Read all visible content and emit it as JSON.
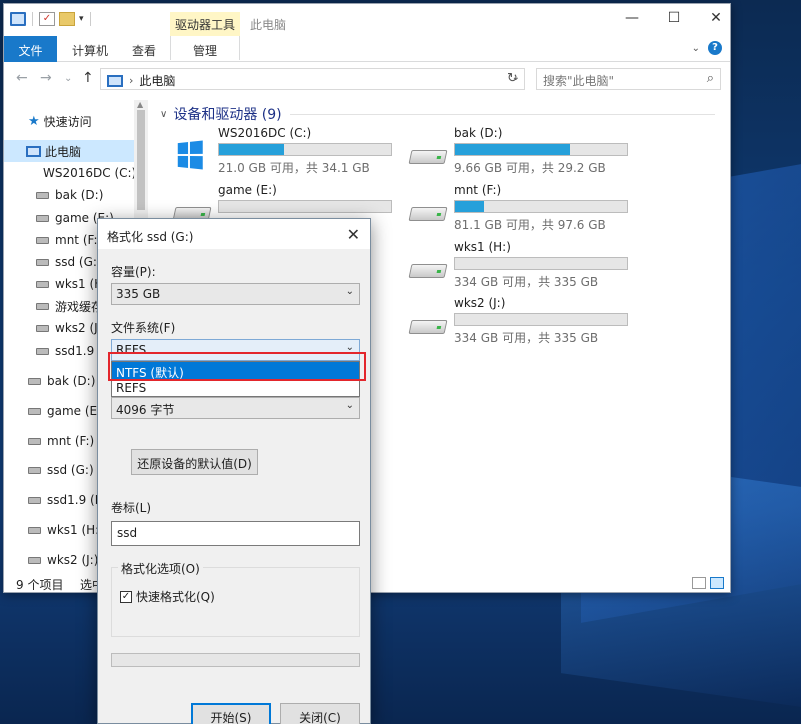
{
  "explorer": {
    "title": "此电脑",
    "ribbon": {
      "file_tab": "文件",
      "tabs": [
        "计算机",
        "查看"
      ],
      "context_header": "驱动器工具",
      "manage_tab": "管理",
      "help_icon": "?"
    },
    "address": {
      "path": "此电脑",
      "search_placeholder": "搜索\"此电脑\""
    },
    "nav": {
      "quick_access": "快速访问",
      "this_pc": "此电脑",
      "items": [
        "WS2016DC (C:)",
        "bak (D:)",
        "game (E:)",
        "mnt (F:)",
        "ssd (G:)",
        "wks1 (H:)",
        "游戏缓存",
        "wks2 (J:)",
        "ssd1.9",
        "bak (D:)",
        "game (E:)",
        "mnt (F:)",
        "ssd (G:)",
        "ssd1.9 (K:)",
        "wks1 (H:)",
        "wks2 (J:)"
      ]
    },
    "group_title": "设备和驱动器 (9)",
    "drives": [
      {
        "name": "WS2016DC (C:)",
        "info": "21.0 GB 可用，共 34.1 GB",
        "used_fraction": 0.38,
        "icon": "windows-drive-icon"
      },
      {
        "name": "bak (D:)",
        "info": "9.66 GB 可用，共 29.2 GB",
        "used_fraction": 0.67,
        "icon": "hard-drive-icon"
      },
      {
        "name": "game (E:)",
        "info": "",
        "used_fraction": 0.0,
        "icon": "hard-drive-icon"
      },
      {
        "name": "mnt (F:)",
        "info": "81.1 GB 可用，共 97.6 GB",
        "used_fraction": 0.17,
        "icon": "hard-drive-icon"
      },
      {
        "name": "wks1 (H:)",
        "info": "334 GB 可用，共 335 GB",
        "used_fraction": 0.0,
        "icon": "hard-drive-icon"
      },
      {
        "name": "wks2 (J:)",
        "info": "334 GB 可用，共 335 GB",
        "used_fraction": 0.0,
        "icon": "hard-drive-icon"
      }
    ],
    "status": {
      "count": "9 个项目",
      "selected": "选中"
    }
  },
  "format_dialog": {
    "title": "格式化 ssd (G:)",
    "capacity_label": "容量(P):",
    "capacity_value": "335 GB",
    "filesystem_label": "文件系统(F)",
    "filesystem_value": "REFS",
    "filesystem_options": [
      "NTFS (默认)",
      "REFS"
    ],
    "allocation_value": "4096 字节",
    "restore_button": "还原设备的默认值(D)",
    "volume_label": "卷标(L)",
    "volume_value": "ssd",
    "format_options_label": "格式化选项(O)",
    "quick_format_label": "快速格式化(Q)",
    "quick_format_checked": true,
    "start_button": "开始(S)",
    "close_button": "关闭(C)"
  },
  "colors": {
    "accent": "#1979ca",
    "selection": "#0078d7",
    "drive_bar": "#26a0da",
    "highlight_box": "#e3262c"
  }
}
